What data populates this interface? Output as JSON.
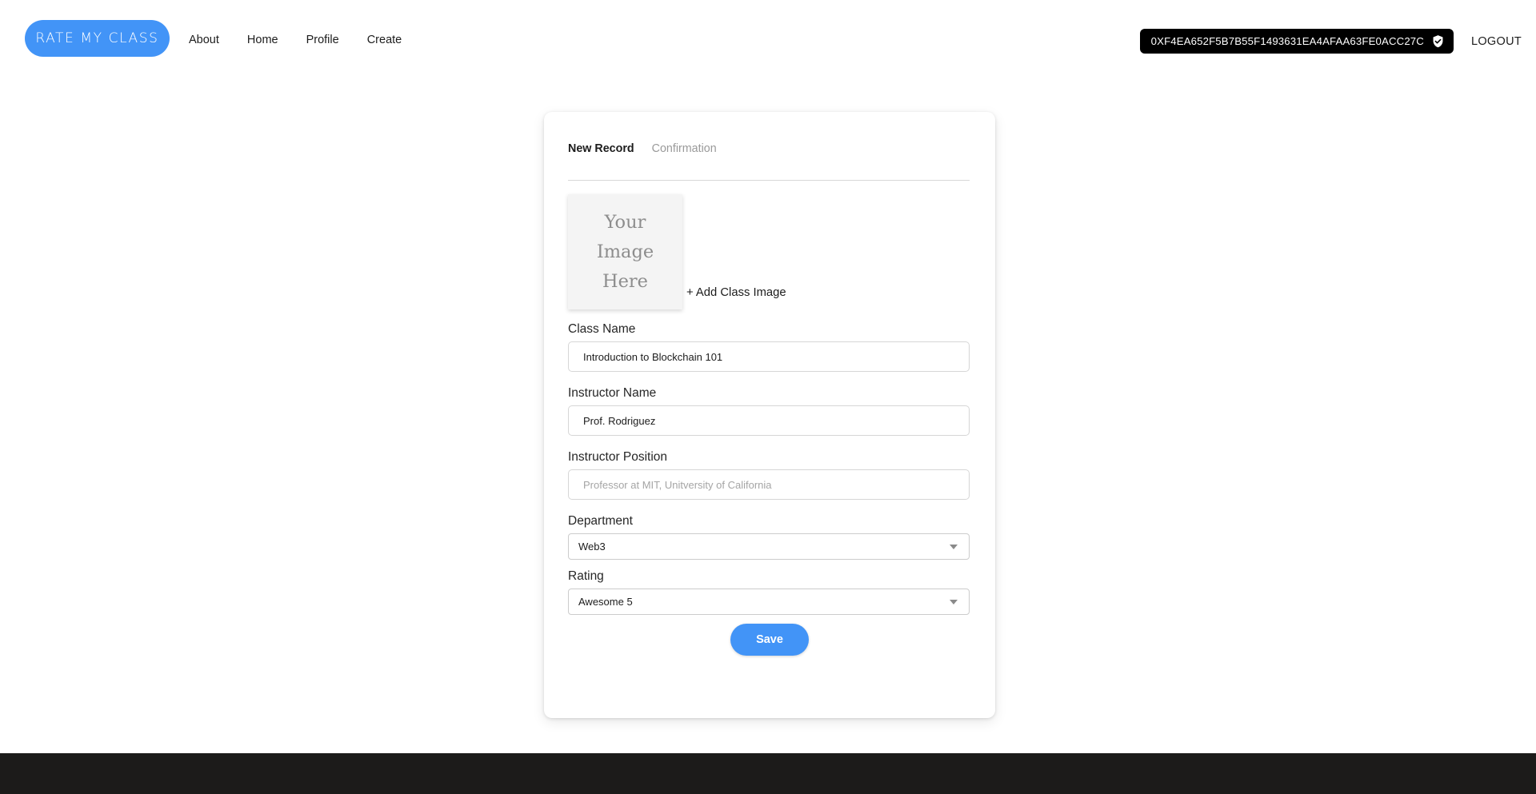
{
  "header": {
    "brand": "RATE MY CLASS",
    "nav": [
      {
        "label": "About"
      },
      {
        "label": "Home"
      },
      {
        "label": "Profile"
      },
      {
        "label": "Create"
      }
    ],
    "wallet": {
      "address": "0XF4EA652F5B7B55F1493631EA4AFAA63FE0ACC27C",
      "badge_icon": "shield-check-icon",
      "chip_background": "#000000"
    },
    "logout_label": "LOGOUT"
  },
  "card": {
    "tabs": [
      {
        "label": "New Record",
        "active": true
      },
      {
        "label": "Confirmation",
        "active": false
      }
    ],
    "image_picker": {
      "placeholder_line1": "Your",
      "placeholder_line2": "Image",
      "placeholder_line3": "Here",
      "add_label": "+ Add Class Image"
    },
    "fields": {
      "class_name": {
        "label": "Class Name",
        "value": "Introduction to Blockchain 101",
        "placeholder": ""
      },
      "instructor_name": {
        "label": "Instructor Name",
        "value": "Prof. Rodriguez",
        "placeholder": ""
      },
      "instructor_position": {
        "label": "Instructor Position",
        "value": "",
        "placeholder": "Professor at MIT, Unitversity of California"
      },
      "department": {
        "label": "Department",
        "value": "Web3"
      },
      "rating": {
        "label": "Rating",
        "value": "Awesome 5"
      }
    },
    "save_label": "Save"
  },
  "theme": {
    "accent": "#4294f7",
    "footer": "#1c1b1a",
    "text": "#1c1c1c",
    "muted": "#9a9a9a"
  }
}
